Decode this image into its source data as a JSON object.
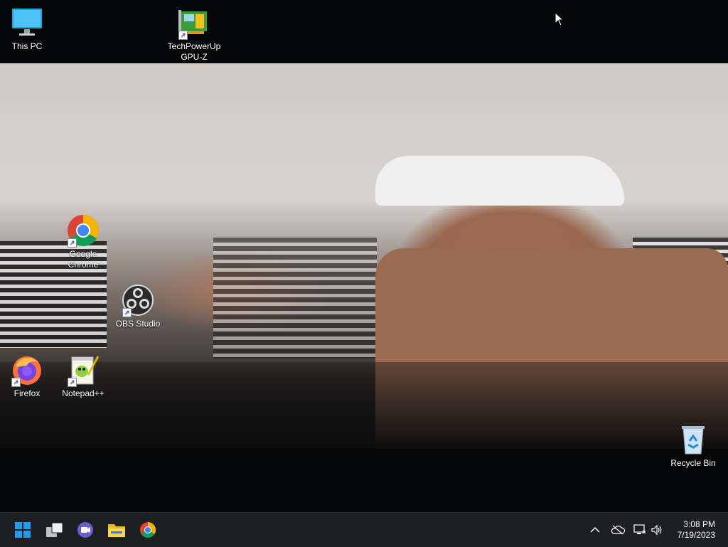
{
  "desktop": {
    "icons": [
      {
        "label_line1": "This PC",
        "label_line2": "",
        "icon": "monitor-icon"
      },
      {
        "label_line1": "TechPowerUp",
        "label_line2": "GPU-Z",
        "icon": "gpu-z-icon"
      },
      {
        "label_line1": "Google",
        "label_line2": "Chrome",
        "icon": "chrome-icon"
      },
      {
        "label_line1": "OBS Studio",
        "label_line2": "",
        "icon": "obs-icon"
      },
      {
        "label_line1": "Firefox",
        "label_line2": "",
        "icon": "firefox-icon"
      },
      {
        "label_line1": "Notepad++",
        "label_line2": "",
        "icon": "notepad-plus-plus-icon"
      },
      {
        "label_line1": "Recycle Bin",
        "label_line2": "",
        "icon": "recycle-bin-icon"
      }
    ]
  },
  "taskbar": {
    "pinned": [
      "start-icon",
      "task-view-icon",
      "teams-chat-icon",
      "file-explorer-icon",
      "chrome-icon"
    ],
    "tray": [
      "chevron-up-icon",
      "onedrive-offline-icon",
      "network-icon",
      "volume-icon"
    ],
    "clock": {
      "time": "3:08 PM",
      "date": "7/19/2023"
    }
  },
  "colors": {
    "taskbar_bg": "#1e1f22",
    "desktop_bg": "#050608",
    "start_blue": "#1f9cf0"
  }
}
